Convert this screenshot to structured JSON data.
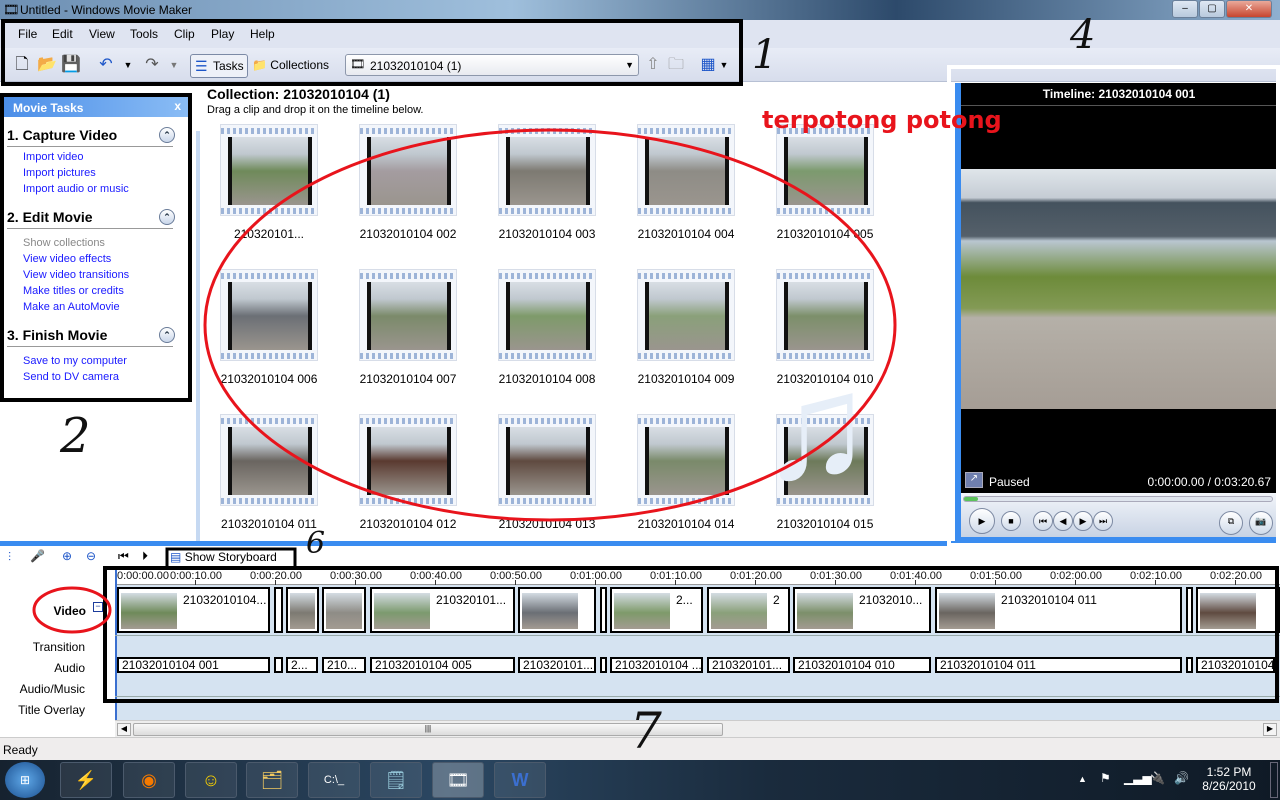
{
  "window": {
    "title": "Untitled - Windows Movie Maker",
    "controls": [
      "–",
      "▢",
      "✕"
    ]
  },
  "menu": [
    "File",
    "Edit",
    "View",
    "Tools",
    "Clip",
    "Play",
    "Help"
  ],
  "toolbar": {
    "tasks_label": "Tasks",
    "collections_label": "Collections",
    "collection_select": "21032010104 (1)"
  },
  "tasks": {
    "header": "Movie Tasks",
    "close": "x",
    "sections": [
      {
        "title": "1. Capture Video",
        "links": [
          {
            "label": "Import video"
          },
          {
            "label": "Import pictures"
          },
          {
            "label": "Import audio or music"
          }
        ]
      },
      {
        "title": "2. Edit Movie",
        "links": [
          {
            "label": "Show collections",
            "disabled": true
          },
          {
            "label": "View video effects"
          },
          {
            "label": "View video transitions"
          },
          {
            "label": "Make titles or credits"
          },
          {
            "label": "Make an AutoMovie"
          }
        ]
      },
      {
        "title": "3. Finish Movie",
        "links": [
          {
            "label": "Save to my computer"
          },
          {
            "label": "Send to DV camera"
          }
        ]
      }
    ]
  },
  "collection": {
    "title": "Collection: 21032010104 (1)",
    "subtitle": "Drag a clip and drop it on the timeline below.",
    "clips": [
      "210320101...",
      "21032010104 002",
      "21032010104 003",
      "21032010104 004",
      "21032010104 005",
      "21032010104 006",
      "21032010104 007",
      "21032010104 008",
      "21032010104 009",
      "21032010104 010",
      "21032010104 011",
      "21032010104 012",
      "21032010104 013",
      "21032010104 014",
      "21032010104 015"
    ]
  },
  "preview": {
    "title": "Timeline: 21032010104 001",
    "status": "Paused",
    "time": "0:00:00.00 / 0:03:20.67",
    "progress": 0
  },
  "timeline": {
    "show_storyboard": "Show Storyboard",
    "tracks": [
      "Video",
      "Transition",
      "Audio",
      "Audio/Music",
      "Title Overlay"
    ],
    "ruler": [
      "0:00:00.00",
      "0:00:10.00",
      "0:00:20.00",
      "0:00:30.00",
      "0:00:40.00",
      "0:00:50.00",
      "0:01:00.00",
      "0:01:10.00",
      "0:01:20.00",
      "0:01:30.00",
      "0:01:40.00",
      "0:01:50.00",
      "0:02:00.00",
      "0:02:10.00",
      "0:02:20.00"
    ],
    "video_clips": [
      "21032010104...",
      "",
      "",
      "",
      "210320101...",
      "",
      "",
      "2...",
      "2",
      "21032010...",
      "21032010104 011",
      "",
      ""
    ],
    "audio_clips": [
      "21032010104 001",
      "",
      "2...",
      "210...",
      "21032010104 005",
      "210320101...",
      "",
      "21032010104 ...",
      "210320101...",
      "21032010104 010",
      "21032010104 011",
      "",
      "21032010104"
    ]
  },
  "status": {
    "text": "Ready"
  },
  "taskbar": {
    "time": "1:52 PM",
    "date": "8/26/2010"
  },
  "annotations": {
    "caption": "terpotong potong",
    "numbers": [
      "1",
      "2",
      "4",
      "6",
      "7"
    ],
    "caption_color": "#e8141c"
  }
}
